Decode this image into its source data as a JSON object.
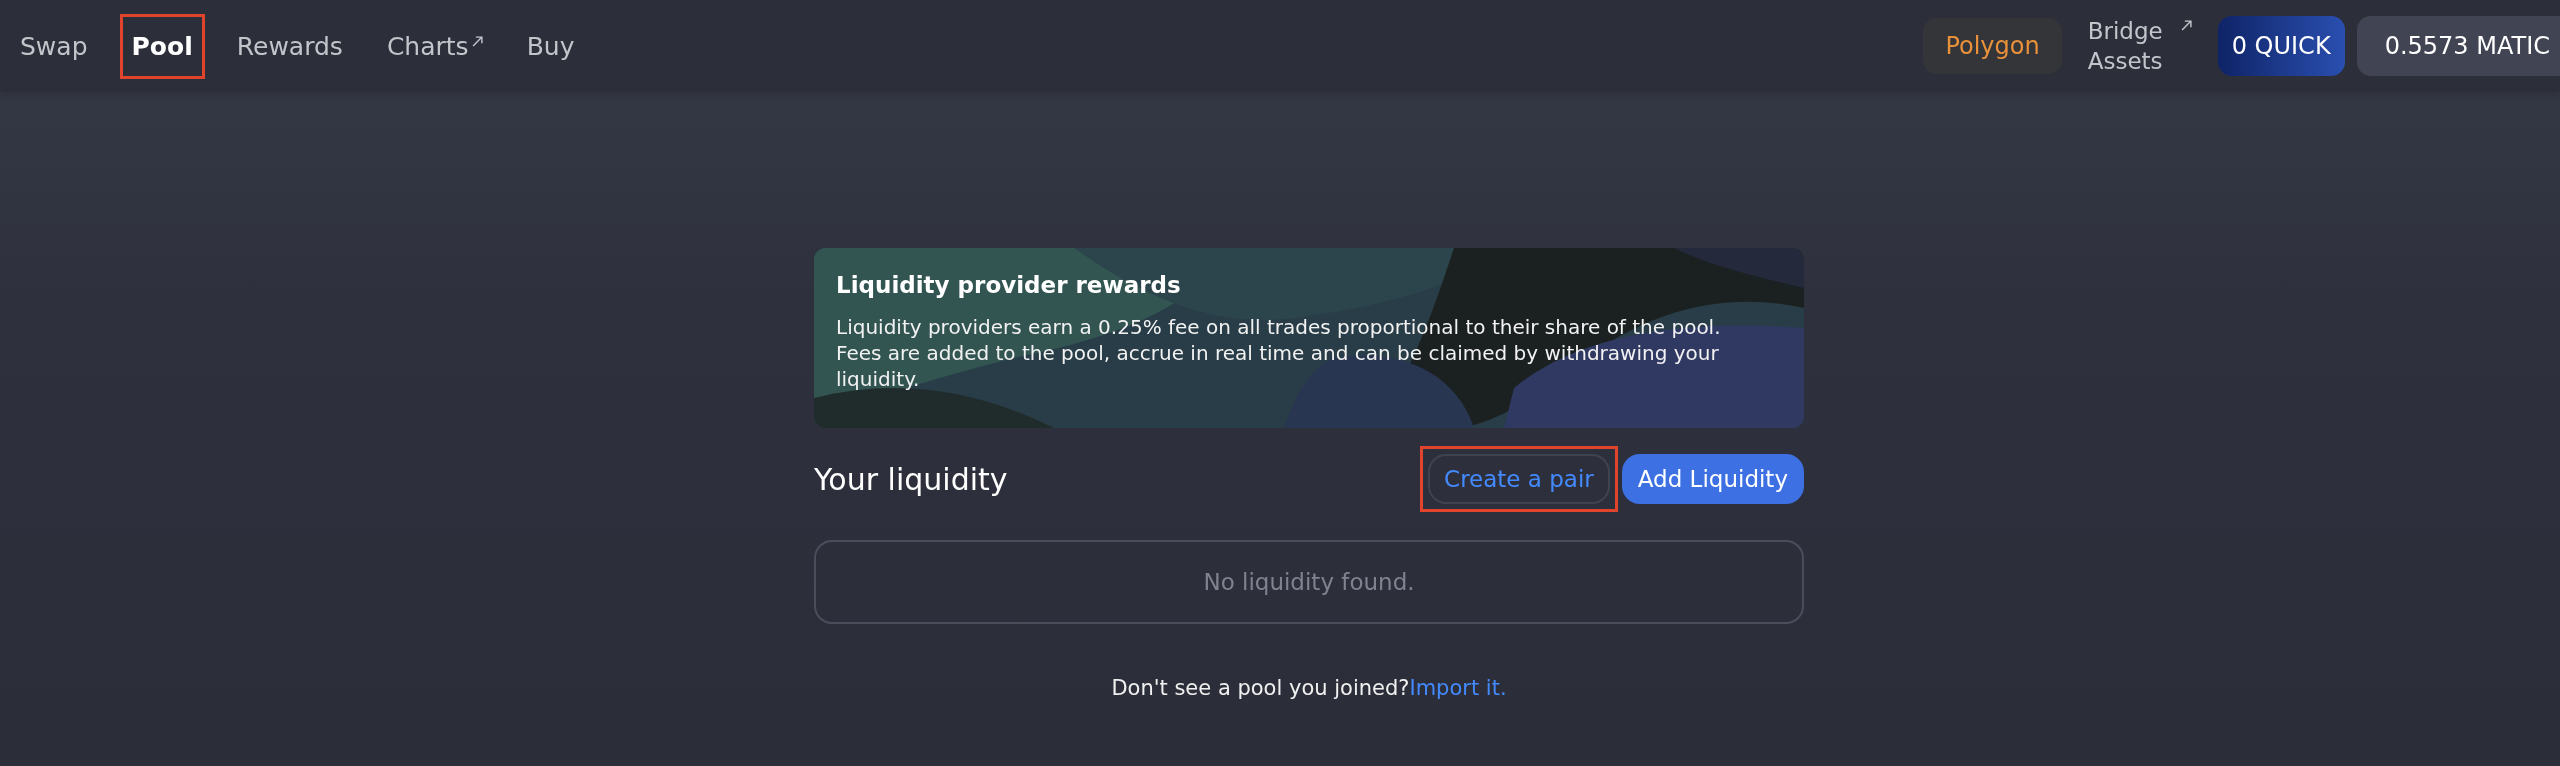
{
  "nav": {
    "links": [
      {
        "label": "Swap",
        "selected": false,
        "external": false,
        "highlighted": false
      },
      {
        "label": "Pool",
        "selected": true,
        "external": false,
        "highlighted": true
      },
      {
        "label": "Rewards",
        "selected": false,
        "external": false,
        "highlighted": false
      },
      {
        "label": "Charts",
        "selected": false,
        "external": true,
        "highlighted": false
      },
      {
        "label": "Buy",
        "selected": false,
        "external": false,
        "highlighted": false
      }
    ]
  },
  "header_right": {
    "network": "Polygon",
    "bridge": {
      "label": "Bridge Assets",
      "external": true
    },
    "quick_balance": "0 QUICK",
    "matic_balance": "0.5573 MATIC"
  },
  "banner": {
    "kind": "picture",
    "title": "Liquidity provider rewards",
    "text": "Liquidity providers earn a 0.25% fee on all trades proportional to their share of the pool. Fees are added to the pool, accrue in real time and can be claimed by withdrawing your liquidity."
  },
  "liquidity": {
    "heading": "Your liquidity",
    "buttons": [
      {
        "label": "Create a pair",
        "kind": "outline",
        "highlighted": true
      },
      {
        "label": "Add Liquidity",
        "kind": "primary",
        "highlighted": false
      }
    ],
    "empty_message": "No liquidity found."
  },
  "footer": {
    "text": "Don't see a pool you joined?",
    "link": "Import it."
  }
}
